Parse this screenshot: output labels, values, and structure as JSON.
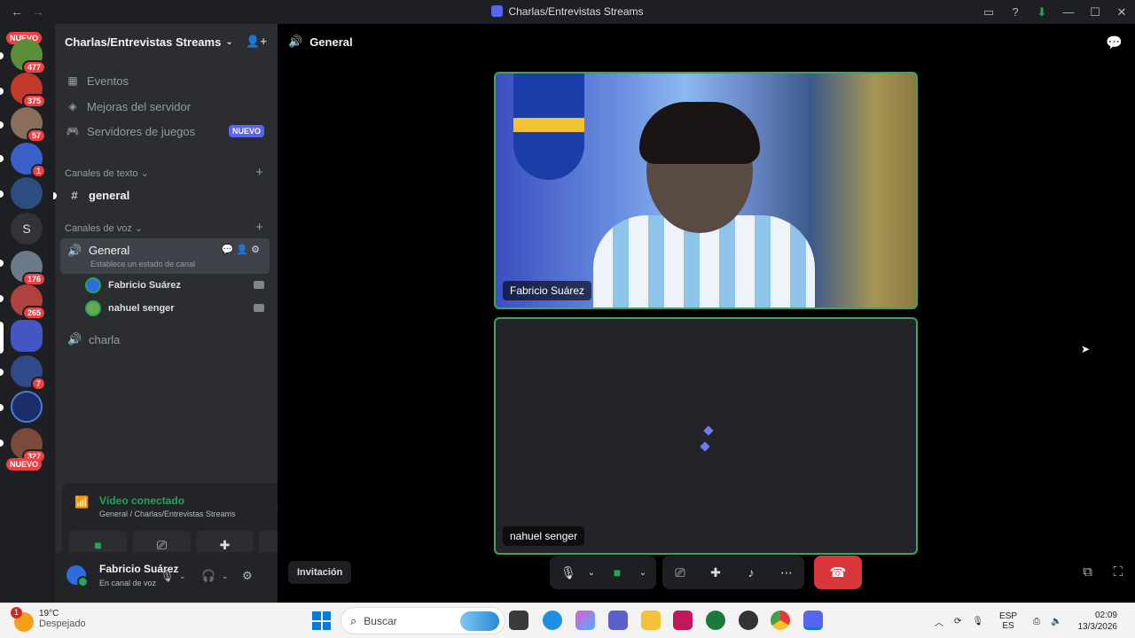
{
  "window": {
    "title": "Charlas/Entrevistas Streams",
    "back": "←",
    "forward": "→",
    "controls": [
      "▭",
      "?",
      "⬇",
      "—",
      "☐",
      "✕"
    ]
  },
  "guilds": {
    "items": [
      {
        "badge": "477",
        "color": "#5a8f3a"
      },
      {
        "badge": "375",
        "color": "#c0392b"
      },
      {
        "badge": "57",
        "color": "#8a6d5a"
      },
      {
        "badge": "1",
        "color": "#3a5fc8"
      },
      {
        "badge": "",
        "color": "#2d4c80"
      },
      {
        "badge": "",
        "color": "#313338",
        "letter": "S"
      },
      {
        "badge": "176",
        "color": "#6b7a8a"
      },
      {
        "badge": "265",
        "color": "#b0423d"
      },
      {
        "badge": "",
        "color": "#4555c4"
      },
      {
        "badge": "7",
        "color": "#304a88"
      },
      {
        "badge": "",
        "color": "#1c2e6a"
      },
      {
        "badge": "327",
        "color": "#7a4a3a"
      }
    ],
    "nuevo_top": "NUEVO",
    "nuevo_bottom": "NUEVO"
  },
  "server": {
    "name": "Charlas/Entrevistas Streams",
    "nav": [
      {
        "label": "Eventos",
        "icon": "calendar-icon"
      },
      {
        "label": "Mejoras del servidor",
        "icon": "boost-icon"
      },
      {
        "label": "Servidores de juegos",
        "icon": "gamepad-icon",
        "tag": "NUEVO"
      }
    ],
    "text_category": "Canales de texto",
    "text_channels": [
      {
        "name": "general"
      }
    ],
    "voice_category": "Canales de voz",
    "voice_channels": [
      {
        "name": "General",
        "status_hint": "Establece un estado de canal",
        "users": [
          "Fabricio Suárez",
          "nahuel senger"
        ]
      },
      {
        "name": "charla"
      }
    ]
  },
  "voice_panel": {
    "status": "Vídeo conectado",
    "location": "General / Charlas/Entrevistas Streams"
  },
  "user": {
    "name": "Fabricio Suárez",
    "status": "En canal de voz"
  },
  "call": {
    "channel": "General",
    "participants": [
      {
        "name": "Fabricio Suárez"
      },
      {
        "name": "nahuel senger"
      }
    ],
    "invite_label": "Invitación"
  },
  "taskbar": {
    "temperature": "19°C",
    "weather": "Despejado",
    "weather_badge": "1",
    "search_placeholder": "Buscar",
    "lang_top": "ESP",
    "lang_bottom": "ES",
    "time": "02:09",
    "date": "13/3/2026"
  }
}
